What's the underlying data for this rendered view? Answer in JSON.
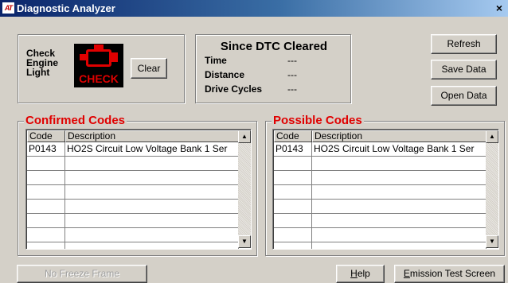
{
  "window": {
    "icon_text": "AT",
    "title": "Diagnostic Analyzer",
    "close_glyph": "×"
  },
  "check_engine": {
    "label_lines": [
      "Check",
      "Engine",
      "Light"
    ],
    "lamp_text": "CHECK",
    "lamp_color": "#e00000",
    "clear_label": "Clear"
  },
  "dtc": {
    "title": "Since DTC Cleared",
    "rows": [
      {
        "label": "Time",
        "value": "---"
      },
      {
        "label": "Distance",
        "value": "---"
      },
      {
        "label": "Drive Cycles",
        "value": "---"
      }
    ]
  },
  "actions": {
    "refresh": "Refresh",
    "save": "Save Data",
    "open": "Open Data"
  },
  "confirmed": {
    "title": "Confirmed Codes",
    "col_code": "Code",
    "col_desc": "Description",
    "rows": [
      {
        "code": "P0143",
        "desc": "HO2S Circuit Low Voltage Bank 1 Ser"
      },
      {
        "code": "",
        "desc": ""
      },
      {
        "code": "",
        "desc": ""
      },
      {
        "code": "",
        "desc": ""
      },
      {
        "code": "",
        "desc": ""
      },
      {
        "code": "",
        "desc": ""
      },
      {
        "code": "",
        "desc": ""
      },
      {
        "code": "",
        "desc": ""
      }
    ]
  },
  "possible": {
    "title": "Possible Codes",
    "col_code": "Code",
    "col_desc": "Description",
    "rows": [
      {
        "code": "P0143",
        "desc": "HO2S Circuit Low Voltage Bank 1 Ser"
      },
      {
        "code": "",
        "desc": ""
      },
      {
        "code": "",
        "desc": ""
      },
      {
        "code": "",
        "desc": ""
      },
      {
        "code": "",
        "desc": ""
      },
      {
        "code": "",
        "desc": ""
      },
      {
        "code": "",
        "desc": ""
      },
      {
        "code": "",
        "desc": ""
      }
    ]
  },
  "footer": {
    "no_freeze": "No Freeze Frame",
    "help_u": "H",
    "help_rest": "elp",
    "emission_u": "E",
    "emission_rest": "mission Test Screen"
  },
  "scroll": {
    "up": "▲",
    "down": "▼"
  }
}
